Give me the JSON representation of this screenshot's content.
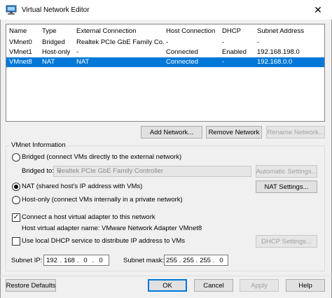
{
  "window": {
    "title": "Virtual Network Editor",
    "close_glyph": "✕"
  },
  "table": {
    "columns": [
      "Name",
      "Type",
      "External Connection",
      "Host Connection",
      "DHCP",
      "Subnet Address"
    ],
    "rows": [
      [
        "VMnet0",
        "Bridged",
        "Realtek PCIe GbE Family Co...",
        "-",
        "-",
        "-"
      ],
      [
        "VMnet1",
        "Host-only",
        "-",
        "Connected",
        "Enabled",
        "192.168.198.0"
      ],
      [
        "VMnet8",
        "NAT",
        "NAT",
        "Connected",
        "-",
        "192.168.0.0"
      ]
    ],
    "selected_row": 2
  },
  "list_buttons": {
    "add": "Add Network...",
    "remove": "Remove Network",
    "rename": "Rename Network..."
  },
  "vmnet_info": {
    "group_label": "VMnet Information",
    "bridged_label": "Bridged (connect VMs directly to the external network)",
    "bridged_to_label": "Bridged to:",
    "bridged_to_value": "Realtek PCIe GbE Family Controller",
    "automatic_settings": "Automatic Settings...",
    "nat_label": "NAT (shared host's IP address with VMs)",
    "nat_settings": "NAT Settings...",
    "hostonly_label": "Host-only (connect VMs internally in a private network)",
    "connect_adapter_label": "Connect a host virtual adapter to this network",
    "connect_adapter_checked": true,
    "adapter_name_text": "Host virtual adapter name: VMware Network Adapter VMnet8",
    "dhcp_label": "Use local DHCP service to distribute IP address to VMs",
    "dhcp_checked": false,
    "dhcp_settings": "DHCP Settings...",
    "subnet_ip_label": "Subnet IP:",
    "subnet_ip": [
      "192",
      "168",
      "0",
      "0"
    ],
    "subnet_mask_label": "Subnet mask:",
    "subnet_mask": [
      "255",
      "255",
      "255",
      "0"
    ],
    "selected_mode": "nat"
  },
  "footer": {
    "restore": "Restore Defaults",
    "ok": "OK",
    "cancel": "Cancel",
    "apply": "Apply",
    "help": "Help"
  }
}
